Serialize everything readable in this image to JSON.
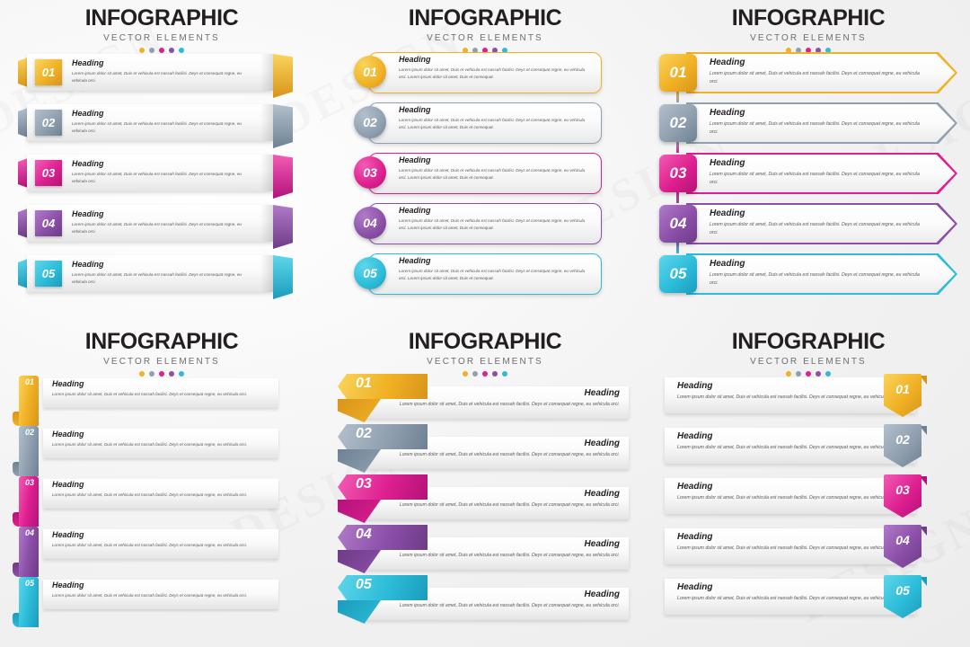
{
  "header": {
    "title": "INFOGRAPHIC",
    "subtitle": "VECTOR ELEMENTS"
  },
  "theme": {
    "colors": [
      "#F0B125",
      "#90A0B0",
      "#DE1F8F",
      "#8B4FA8",
      "#2CBCD9"
    ],
    "dark": [
      "#D9941A",
      "#6E8194",
      "#B3127A",
      "#6E3B87",
      "#1B9CBC"
    ],
    "light": [
      "#FAD45C",
      "#B3C0CC",
      "#F25CB5",
      "#B07BC9",
      "#5FD6EA"
    ]
  },
  "content": {
    "heading": "Heading",
    "body": "Lorem ipsum dolor sit amet, Duis et vehicula est nassah facilisi. Deys et consequat regne, eu vehicula orci.",
    "body_extra": "Lorem ipsum dolor sit amet, Duis et consequat."
  },
  "numbers": [
    "01",
    "02",
    "03",
    "04",
    "05"
  ],
  "panels": [
    {
      "id": "panel-1",
      "style": "flap-bars"
    },
    {
      "id": "panel-2",
      "style": "rounded-cards"
    },
    {
      "id": "panel-3",
      "style": "arrow-outlines"
    },
    {
      "id": "panel-4",
      "style": "vertical-ribbon"
    },
    {
      "id": "panel-5",
      "style": "banner-arrows"
    },
    {
      "id": "panel-6",
      "style": "pennant-right"
    }
  ],
  "watermarks": [
    "DESIGN",
    "DESIGN",
    "DESIGN",
    "DESIGN",
    "DESIGN",
    "DESIGN"
  ]
}
